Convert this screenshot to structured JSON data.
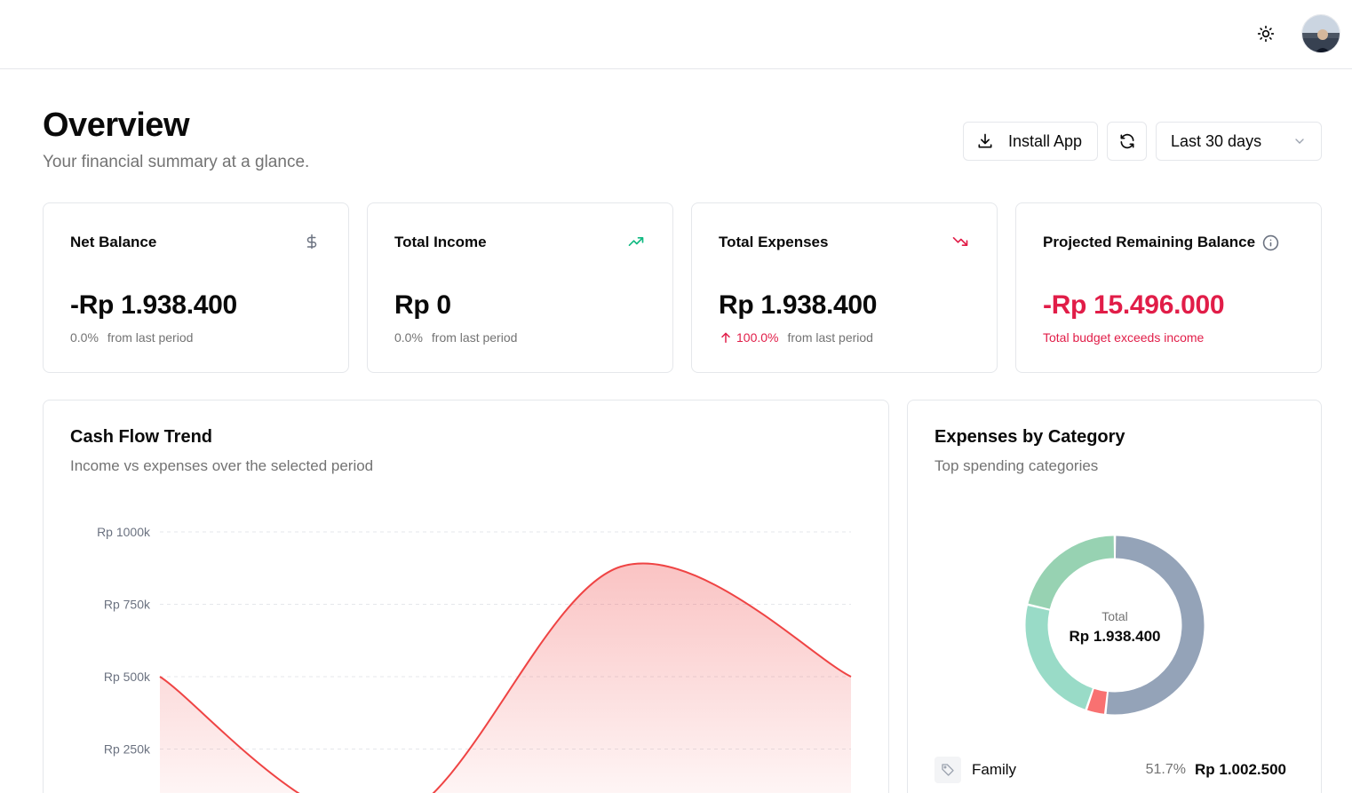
{
  "header": {
    "theme_icon": "sun-icon",
    "avatar_icon": "user-avatar"
  },
  "overview": {
    "title": "Overview",
    "subtitle": "Your financial summary at a glance.",
    "install_label": "Install App",
    "range_value": "Last 30 days"
  },
  "stats": [
    {
      "title": "Net Balance",
      "icon": "dollar-icon",
      "value": "-Rp 1.938.400",
      "change": "0.0%",
      "change_suffix": "from last period"
    },
    {
      "title": "Total Income",
      "icon": "trending-up-icon",
      "value": "Rp 0",
      "change": "0.0%",
      "change_suffix": "from last period"
    },
    {
      "title": "Total Expenses",
      "icon": "trending-down-icon",
      "value": "Rp 1.938.400",
      "change": "100.0%",
      "change_suffix": "from last period"
    },
    {
      "title": "Projected Remaining Balance",
      "icon": "info-icon",
      "value": "-Rp 15.496.000",
      "note": "Total budget exceeds income"
    }
  ],
  "colors": {
    "expense_line": "#ef4444",
    "alert": "#e11d48",
    "income_icon": "#10b981"
  },
  "cashflow": {
    "title": "Cash Flow Trend",
    "subtitle": "Income vs expenses over the selected period"
  },
  "expenses_by_category": {
    "title": "Expenses by Category",
    "subtitle": "Top spending categories",
    "total_label": "Total",
    "total_value": "Rp 1.938.400",
    "legend": [
      {
        "name": "Family",
        "percent": "51.7%",
        "amount": "Rp 1.002.500",
        "icon": "tag-icon"
      }
    ]
  },
  "chart_data": [
    {
      "type": "area",
      "title": "Cash Flow Trend",
      "yticks": [
        "Rp 250k",
        "Rp 500k",
        "Rp 750k",
        "Rp 1000k"
      ],
      "ylim": [
        0,
        1000
      ],
      "series": [
        {
          "values": [
            500,
            0,
            880,
            500
          ]
        }
      ],
      "grid": true
    },
    {
      "type": "pie",
      "title": "Expenses by Category",
      "slices": [
        {
          "label": "Family",
          "value": 51.7,
          "color": "#94a3b8"
        },
        {
          "value": 3.5,
          "color": "#f87171"
        },
        {
          "value": 23.5,
          "color": "#99dbc7"
        },
        {
          "value": 21.3,
          "color": "#97d2b2"
        }
      ]
    }
  ]
}
